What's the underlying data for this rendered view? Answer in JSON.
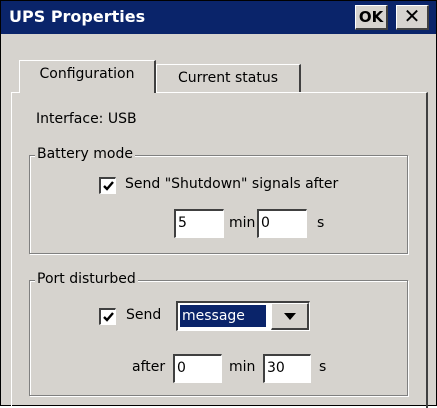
{
  "window": {
    "title": "UPS Properties",
    "ok_label": "OK",
    "close_glyph": "✕"
  },
  "tabs": [
    {
      "label": "Configuration",
      "active": true
    },
    {
      "label": "Current status",
      "active": false
    }
  ],
  "interface_label": "Interface: USB",
  "battery_mode": {
    "title": "Battery mode",
    "checkbox_label": "Send \"Shutdown\" signals after",
    "checked": true,
    "min_value": "5",
    "min_label": "min",
    "sec_value": "0",
    "sec_label": "s"
  },
  "port_disturbed": {
    "title": "Port disturbed",
    "checkbox_label": "Send",
    "checked": true,
    "action_selected": "message",
    "after_label": "after",
    "min_value": "0",
    "min_label": "min",
    "sec_value": "30",
    "sec_label": "s"
  },
  "colors": {
    "titlebar": "#0a246a",
    "face": "#d6d3ce",
    "selection": "#0a246a"
  },
  "icons": {
    "close": "close-icon",
    "check": "checkmark-icon",
    "dropdown_arrow": "chevron-down-icon"
  }
}
